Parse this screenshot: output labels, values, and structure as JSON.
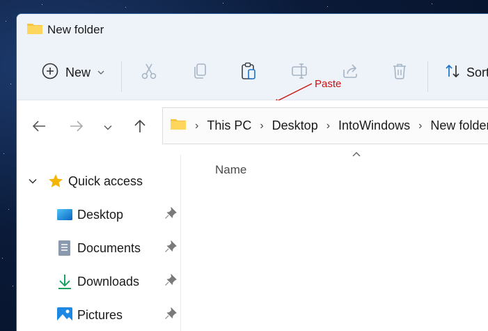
{
  "window": {
    "title": "New folder"
  },
  "toolbar": {
    "new_label": "New",
    "sort_label": "Sort",
    "icons": [
      "cut-icon",
      "copy-icon",
      "paste-icon",
      "rename-icon",
      "share-icon",
      "delete-icon"
    ]
  },
  "annotation": {
    "text": "Paste",
    "color": "#cc1111"
  },
  "address_bar": {
    "crumbs": [
      "This PC",
      "Desktop",
      "IntoWindows",
      "New folder"
    ]
  },
  "file_list": {
    "name_header": "Name"
  },
  "sidebar": {
    "quick_access": "Quick access",
    "items": [
      {
        "label": "Desktop",
        "icon": "desktop-icon"
      },
      {
        "label": "Documents",
        "icon": "documents-icon"
      },
      {
        "label": "Downloads",
        "icon": "downloads-icon"
      },
      {
        "label": "Pictures",
        "icon": "pictures-icon"
      }
    ]
  }
}
